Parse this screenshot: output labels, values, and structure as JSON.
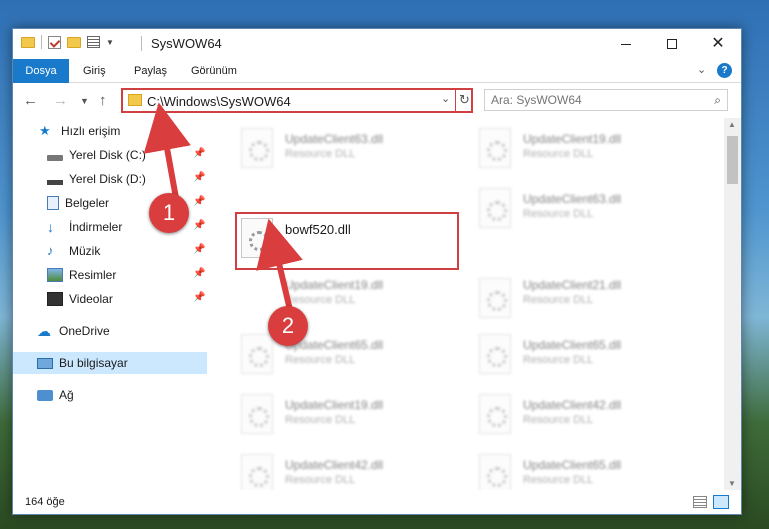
{
  "window": {
    "title": "SysWOW64"
  },
  "ribbon": {
    "tabs": [
      "Dosya",
      "Giriş",
      "Paylaş",
      "Görünüm"
    ]
  },
  "address": {
    "path": "C:\\Windows\\SysWOW64"
  },
  "search": {
    "placeholder": "Ara: SysWOW64"
  },
  "sidebar": {
    "items": [
      {
        "label": "Hızlı erişim",
        "icon": "star-icon"
      },
      {
        "label": "Yerel Disk (C:)",
        "icon": "drive-icon"
      },
      {
        "label": "Yerel Disk (D:)",
        "icon": "drive-icon"
      },
      {
        "label": "Belgeler",
        "icon": "documents-icon"
      },
      {
        "label": "İndirmeler",
        "icon": "download-icon"
      },
      {
        "label": "Müzik",
        "icon": "music-icon"
      },
      {
        "label": "Resimler",
        "icon": "pictures-icon"
      },
      {
        "label": "Videolar",
        "icon": "video-icon"
      },
      {
        "label": "OneDrive",
        "icon": "cloud-icon"
      },
      {
        "label": "Bu bilgisayar",
        "icon": "computer-icon"
      },
      {
        "label": "Ağ",
        "icon": "network-icon"
      }
    ]
  },
  "files": [
    {
      "name": "UpdateClient63.dll",
      "type": "Resource DLL"
    },
    {
      "name": "UpdateClient19.dll",
      "type": "Resource DLL"
    },
    {
      "name": "bowf520.dll",
      "type": ""
    },
    {
      "name": "UpdateClient63.dll",
      "type": "Resource DLL"
    },
    {
      "name": "UpdateClient19.dll",
      "type": "Resource DLL"
    },
    {
      "name": "UpdateClient21.dll",
      "type": "Resource DLL"
    },
    {
      "name": "UpdateClient65.dll",
      "type": "Resource DLL"
    },
    {
      "name": "UpdateClient65.dll",
      "type": "Resource DLL"
    },
    {
      "name": "UpdateClient19.dll",
      "type": "Resource DLL"
    },
    {
      "name": "UpdateClient42.dll",
      "type": "Resource DLL"
    },
    {
      "name": "UpdateClient42.dll",
      "type": "Resource DLL"
    },
    {
      "name": "UpdateClient65.dll",
      "type": "Resource DLL"
    }
  ],
  "status": {
    "count": "164 öğe"
  },
  "callouts": [
    "1",
    "2"
  ],
  "colors": {
    "accent": "#1979ca",
    "highlight": "#d04040",
    "callout": "#d93d3d"
  }
}
